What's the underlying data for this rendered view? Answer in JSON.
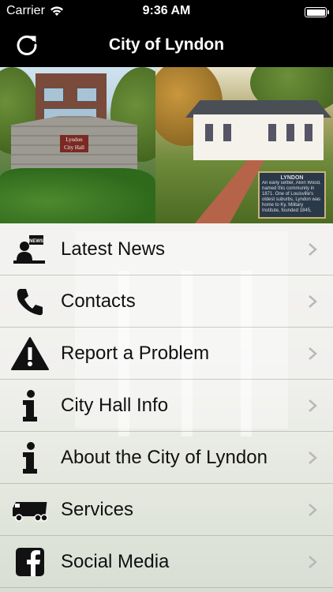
{
  "status_bar": {
    "carrier": "Carrier",
    "time": "9:36 AM"
  },
  "nav": {
    "title": "City of Lyndon"
  },
  "hero": {
    "left_sign": "Lyndon\nCity Hall",
    "right_marker_title": "LYNDON",
    "right_marker_text": "An early settler, Alvin Wood, named this community in 1871. One of Louisville's oldest suburbs, Lyndon was home to Ky. Military Institute, founded 1845, moved here 1896. Forerunner of Central State Hospital in 1873..."
  },
  "menu": {
    "items": [
      {
        "label": "Latest News",
        "icon": "newspaper-icon"
      },
      {
        "label": "Contacts",
        "icon": "phone-icon"
      },
      {
        "label": "Report a Problem",
        "icon": "warning-icon"
      },
      {
        "label": "City Hall Info",
        "icon": "info-icon"
      },
      {
        "label": "About the City of Lyndon",
        "icon": "info-icon"
      },
      {
        "label": "Services",
        "icon": "truck-icon"
      },
      {
        "label": "Social Media",
        "icon": "facebook-icon"
      }
    ]
  },
  "colors": {
    "bar_bg": "#000000",
    "text": "#111111",
    "chevron": "#b8b8b8"
  }
}
